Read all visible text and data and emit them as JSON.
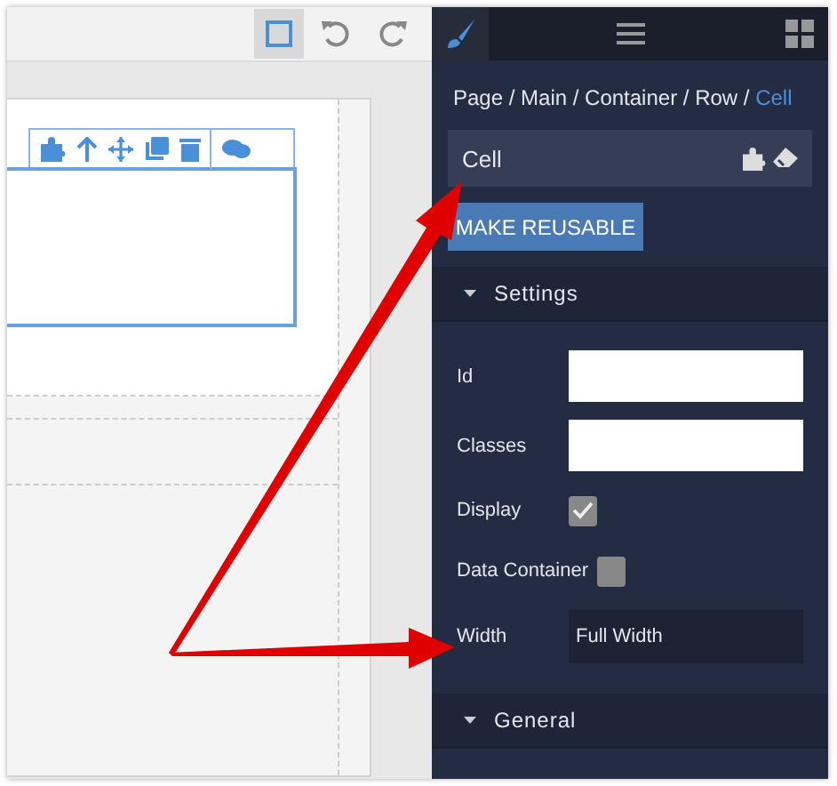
{
  "canvas": {
    "toolbar": [
      {
        "kind": "square",
        "selected": true
      },
      {
        "kind": "undo",
        "selected": false
      },
      {
        "kind": "redo",
        "selected": false
      }
    ]
  },
  "panel": {
    "tabs": [
      {
        "kind": "brush",
        "selected": true
      },
      {
        "kind": "menu",
        "selected": false
      },
      {
        "kind": "grid",
        "selected": false
      }
    ],
    "breadcrumb": {
      "path": "Page / Main / Container / Row /",
      "current": "Cell"
    },
    "element_name": "Cell",
    "button": "MAKE REUSABLE",
    "sections": [
      {
        "title": "Settings",
        "expanded": true,
        "fields": [
          {
            "kind": "text",
            "label": "Id"
          },
          {
            "kind": "text",
            "label": "Classes"
          },
          {
            "kind": "checkbox",
            "label": "Display",
            "checked": true
          },
          {
            "kind": "checkbox",
            "label": "Data Container",
            "checked": false
          },
          {
            "kind": "select",
            "label": "Width",
            "value": "Full Width"
          }
        ]
      },
      {
        "title": "General",
        "expanded": true
      }
    ]
  }
}
